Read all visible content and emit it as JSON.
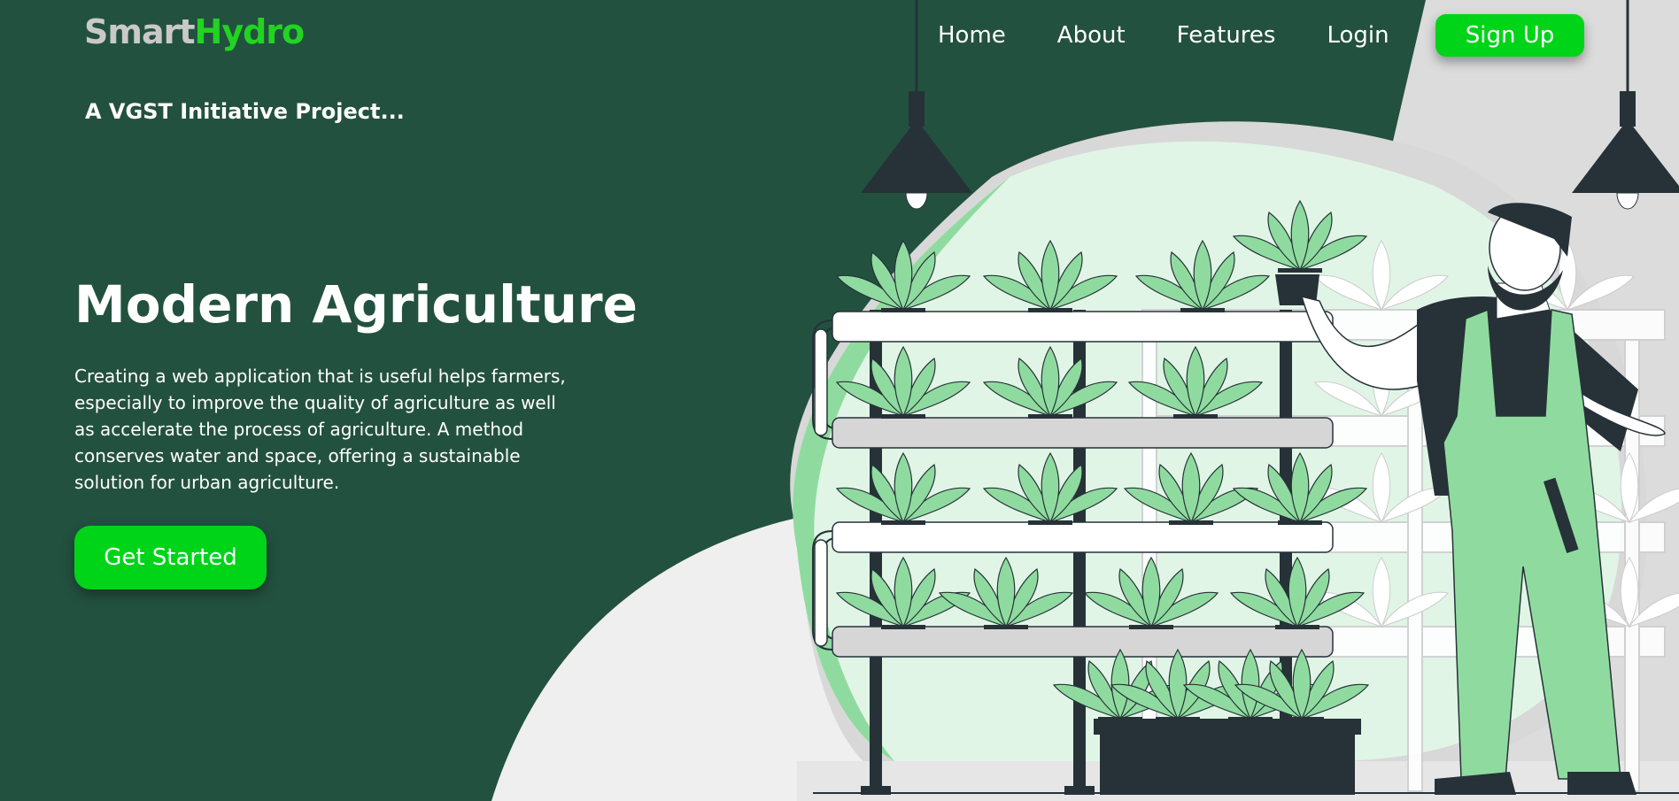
{
  "brand": {
    "part1": "Smart",
    "part2": "Hydro"
  },
  "tagline": "A VGST Initiative Project...",
  "nav": {
    "home": "Home",
    "about": "About",
    "features": "Features",
    "login": "Login",
    "signup": "Sign Up"
  },
  "hero": {
    "title": "Modern Agriculture",
    "description": "Creating a web application that is useful helps farmers, especially to improve the quality of agriculture as well as accelerate the process of agriculture. A method conserves water and space, offering a sustainable solution for urban agriculture.",
    "cta": "Get Started"
  },
  "colors": {
    "background": "#23513f",
    "accent": "#00d419",
    "plant": "#8fdb9f",
    "dark": "#263238"
  }
}
